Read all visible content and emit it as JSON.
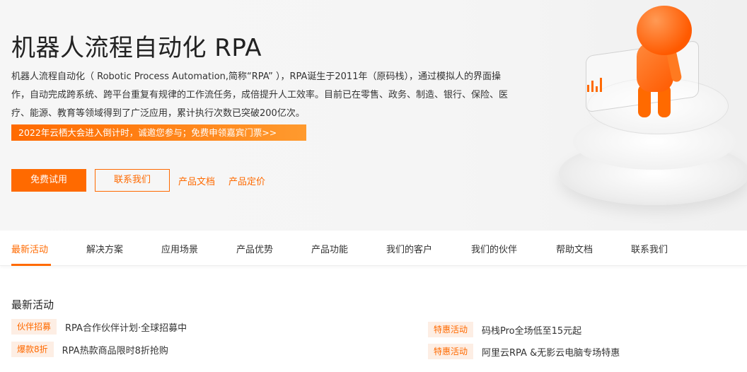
{
  "hero": {
    "title": "机器人流程自动化 RPA",
    "description": "机器人流程自动化（ Robotic Process Automation,简称“RPA” ），RPA诞生于2011年（原码栈），通过模拟人的界面操作，自动完成跨系统、跨平台重复有规律的工作流任务，成倍提升人工效率。目前已在零售、政务、制造、银行、保险、医疗、能源、教育等领域得到了广泛应用，累计执行次数已突破200亿次。",
    "promo_banner": "2022年云栖大会进入倒计时，诚邀您参与；免费申领嘉宾门票>>",
    "buttons": {
      "free_trial": "免费试用",
      "contact_us": "联系我们"
    },
    "links": {
      "docs": "产品文档",
      "pricing": "产品定价"
    }
  },
  "tabs": [
    {
      "label": "最新活动",
      "active": true
    },
    {
      "label": "解决方案",
      "active": false
    },
    {
      "label": "应用场景",
      "active": false
    },
    {
      "label": "产品优势",
      "active": false
    },
    {
      "label": "产品功能",
      "active": false
    },
    {
      "label": "我们的客户",
      "active": false
    },
    {
      "label": "我们的伙伴",
      "active": false
    },
    {
      "label": "帮助文档",
      "active": false
    },
    {
      "label": "联系我们",
      "active": false
    }
  ],
  "activities": {
    "title": "最新活动",
    "items": [
      {
        "badge": "伙伴招募",
        "text": "RPA合作伙伴计划·全球招募中"
      },
      {
        "badge": "爆款8折",
        "text": "RPA热款商品限时8折抢购"
      },
      {
        "badge": "特惠活动",
        "text": "码栈Pro全场低至15元起"
      },
      {
        "badge": "特惠活动",
        "text": "阿里云RPA &无影云电脑专场特惠"
      }
    ]
  },
  "colors": {
    "accent": "#ff6a00",
    "badge_bg": "#fdeee4",
    "hero_bg": "#f5f5f5"
  }
}
